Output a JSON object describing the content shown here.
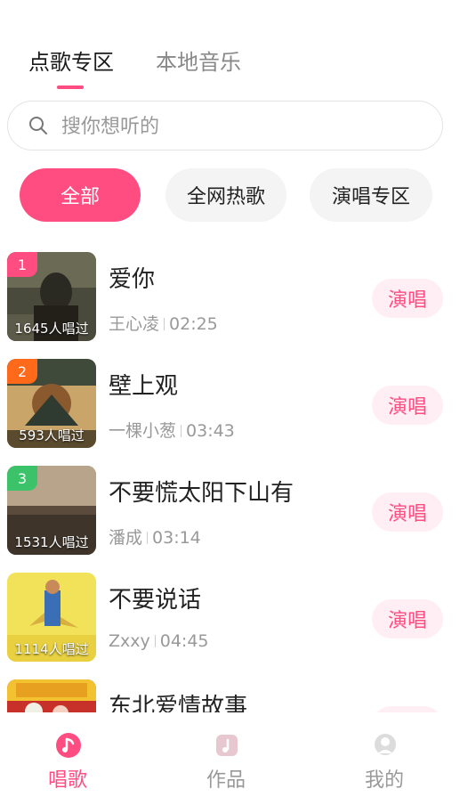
{
  "tabs": [
    {
      "label": "点歌专区",
      "active": true
    },
    {
      "label": "本地音乐",
      "active": false
    }
  ],
  "search": {
    "placeholder": "搜你想听的",
    "icon": "search-icon"
  },
  "chips": [
    {
      "label": "全部",
      "active": true
    },
    {
      "label": "全网热歌",
      "active": false
    },
    {
      "label": "演唱专区",
      "active": false
    }
  ],
  "songs": [
    {
      "rank": "1",
      "count": "1645人唱过",
      "title": "爱你",
      "artist": "王心凌",
      "duration": "02:25",
      "action": "演唱"
    },
    {
      "rank": "2",
      "count": "593人唱过",
      "title": "壁上观",
      "artist": "一棵小葱",
      "duration": "03:43",
      "action": "演唱"
    },
    {
      "rank": "3",
      "count": "1531人唱过",
      "title": "不要慌太阳下山有",
      "artist": "潘成",
      "duration": "03:14",
      "action": "演唱"
    },
    {
      "rank": "",
      "count": "1114人唱过",
      "title": "不要说话",
      "artist": "Zxxy",
      "duration": "04:45",
      "action": "演唱"
    },
    {
      "rank": "",
      "count": "",
      "title": "东北爱情故事",
      "artist": "",
      "duration": "",
      "action": "演唱"
    }
  ],
  "nav": [
    {
      "label": "唱歌",
      "icon": "music-note-icon",
      "active": true
    },
    {
      "label": "作品",
      "icon": "works-icon",
      "active": false
    },
    {
      "label": "我的",
      "icon": "profile-icon",
      "active": false
    }
  ],
  "colors": {
    "accent": "#ff4d82",
    "rank1": "#ff4d82",
    "rank2": "#ff6a1a",
    "rank3": "#3cc36a",
    "chip_bg": "#f4f4f4"
  }
}
